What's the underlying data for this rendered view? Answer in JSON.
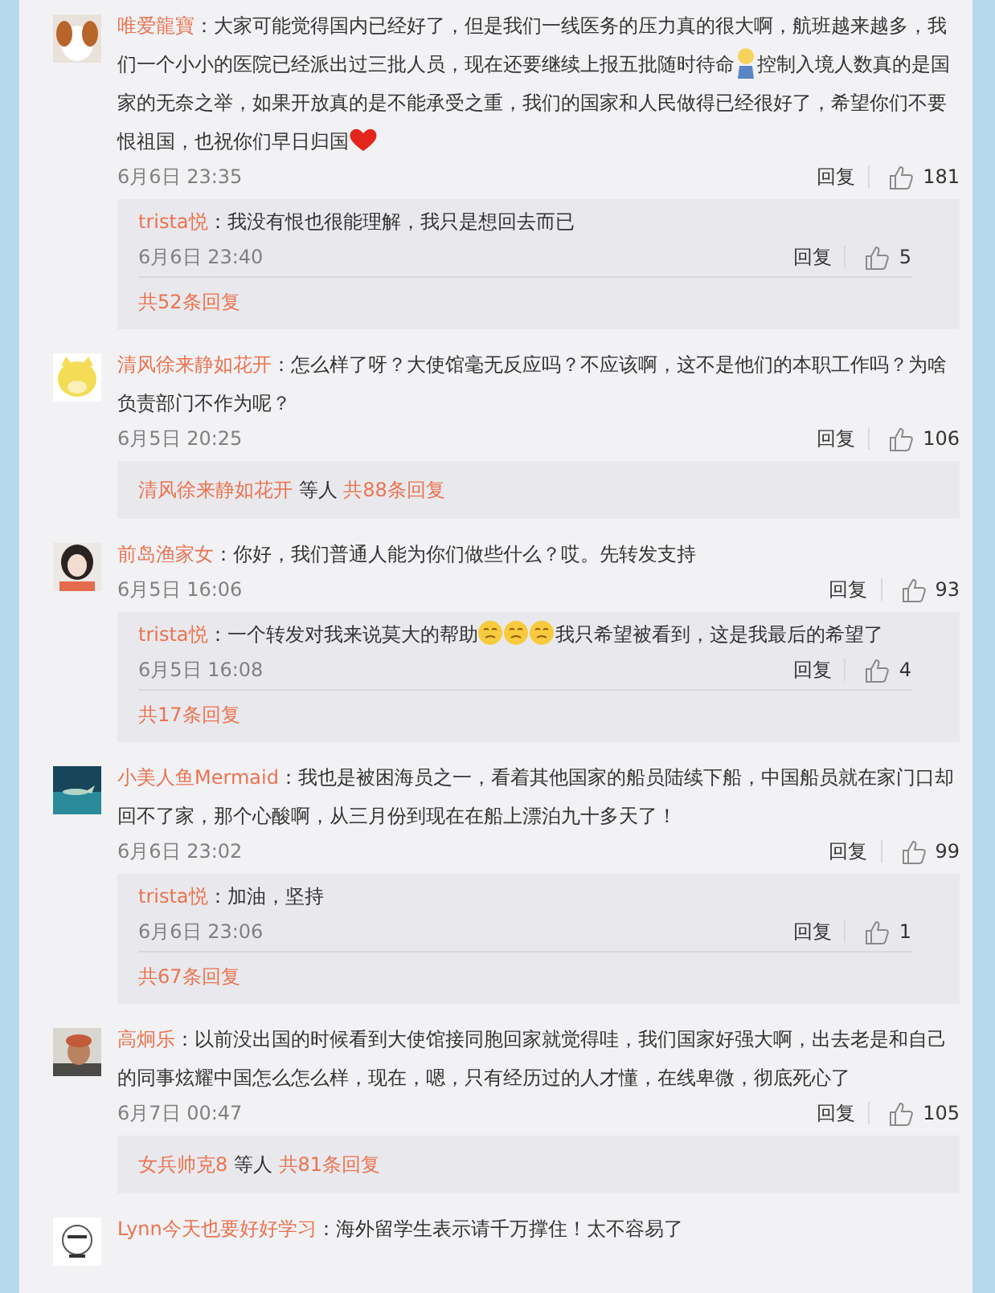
{
  "comments": [
    {
      "user": "唯爱龍寶",
      "body": [
        {
          "kind": "text",
          "text": "：大家可能觉得国内已经好了，但是我们一线医务的压力真的很大啊，航班越来越多，我们一个小小的医院已经派出过三批人员，现在还要继续上报五批随时待命"
        },
        {
          "kind": "figure"
        },
        {
          "kind": "text",
          "text": "控制入境人数真的是国家的无奈之举，如果开放真的是不能承受之重，我们的国家和人民做得已经很好了，希望你们不要恨祖国，也祝你们早日归国"
        },
        {
          "kind": "heart"
        }
      ],
      "date": "6月6日 23:35",
      "reply": "回复",
      "likes": "181",
      "replies": [
        {
          "user": "trista悦",
          "body": [
            {
              "kind": "text",
              "text": "：我没有恨也很能理解，我只是想回去而已"
            }
          ],
          "date": "6月6日 23:40",
          "reply": "回复",
          "likes": "5"
        }
      ],
      "more": {
        "count": "共52条回复"
      }
    },
    {
      "user": "清风徐来静如花开",
      "body": [
        {
          "kind": "text",
          "text": "：怎么样了呀？大使馆毫无反应吗？不应该啊，这不是他们的本职工作吗？为啥负责部门不作为呢？"
        }
      ],
      "date": "6月5日 20:25",
      "reply": "回复",
      "likes": "106",
      "more": {
        "names": "清风徐来静如花开",
        "others": "等人",
        "count": "共88条回复"
      }
    },
    {
      "user": "前岛渔家女",
      "body": [
        {
          "kind": "text",
          "text": "：你好，我们普通人能为你们做些什么？哎。先转发支持"
        }
      ],
      "date": "6月5日 16:06",
      "reply": "回复",
      "likes": "93",
      "replies": [
        {
          "user": "trista悦",
          "body": [
            {
              "kind": "text",
              "text": "：一个转发对我来说莫大的帮助"
            },
            {
              "kind": "face"
            },
            {
              "kind": "face"
            },
            {
              "kind": "face"
            },
            {
              "kind": "text",
              "text": "我只希望被看到，这是我最后的希望了"
            }
          ],
          "date": "6月5日 16:08",
          "reply": "回复",
          "likes": "4"
        }
      ],
      "more": {
        "count": "共17条回复"
      }
    },
    {
      "user": "小美人鱼Mermaid",
      "body": [
        {
          "kind": "text",
          "text": "：我也是被困海员之一，看着其他国家的船员陆续下船，中国船员就在家门口却回不了家，那个心酸啊，从三月份到现在在船上漂泊九十多天了！"
        }
      ],
      "date": "6月6日 23:02",
      "reply": "回复",
      "likes": "99",
      "replies": [
        {
          "user": "trista悦",
          "body": [
            {
              "kind": "text",
              "text": "：加油，坚持"
            }
          ],
          "date": "6月6日 23:06",
          "reply": "回复",
          "likes": "1"
        }
      ],
      "more": {
        "count": "共67条回复"
      }
    },
    {
      "user": "高炯乐",
      "body": [
        {
          "kind": "text",
          "text": "：以前没出国的时候看到大使馆接同胞回家就觉得哇，我们国家好强大啊，出去老是和自己的同事炫耀中国怎么怎么样，现在，嗯，只有经历过的人才懂，在线卑微，彻底死心了"
        }
      ],
      "date": "6月7日 00:47",
      "reply": "回复",
      "likes": "105",
      "more": {
        "names": "女兵帅克8",
        "others": "等人",
        "count": "共81条回复"
      }
    },
    {
      "user": "Lynn今天也要好好学习",
      "body": [
        {
          "kind": "text",
          "text": "：海外留学生表示请千万撑住！太不容易了"
        }
      ]
    }
  ]
}
